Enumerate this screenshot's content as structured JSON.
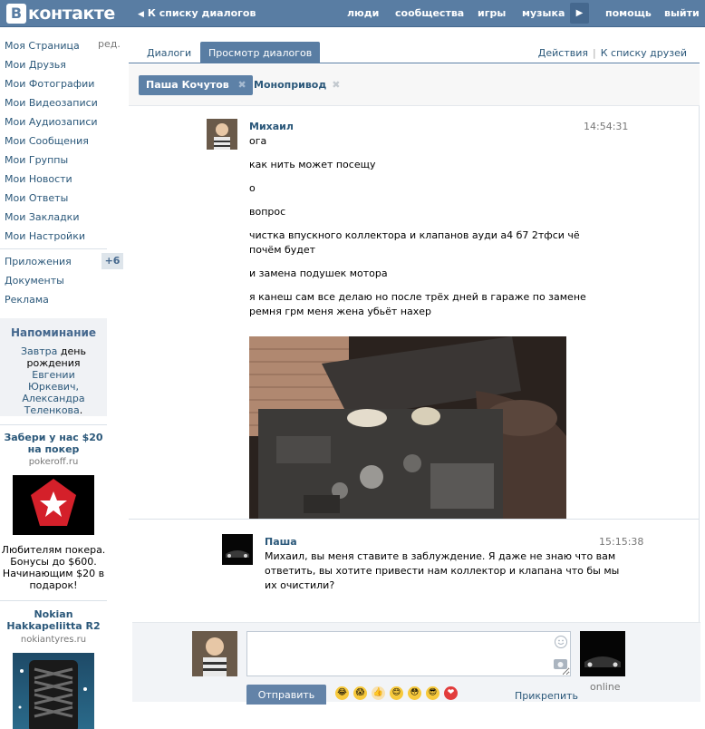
{
  "topbar": {
    "logo_letter": "В",
    "logo_text": "контакте",
    "back_label": "К списку диалогов",
    "nav": [
      "люди",
      "сообщества",
      "игры",
      "музыка",
      "помощь",
      "выйти"
    ]
  },
  "sidebar": {
    "edit_label": "ред.",
    "items": [
      "Моя Страница",
      "Мои Друзья",
      "Мои Фотографии",
      "Мои Видеозаписи",
      "Мои Аудиозаписи",
      "Мои Сообщения",
      "Мои Группы",
      "Мои Новости",
      "Мои Ответы",
      "Мои Закладки",
      "Мои Настройки"
    ],
    "items2": [
      "Приложения",
      "Документы",
      "Реклама"
    ],
    "apps_badge": "+6"
  },
  "reminder": {
    "title": "Напоминание",
    "day_link": "Завтра",
    "text1": "день рождения",
    "people": "Евгении Юркевич, Александра Теленкова",
    "dot": "."
  },
  "ads": [
    {
      "title": "Забери у нас $20 на покер",
      "domain": "pokeroff.ru",
      "text": "Любителям покера. Бонусы до $600. Начинающим $20 в подарок!"
    },
    {
      "title": "Nokian Hakkapeliitta R2",
      "domain": "nokiantyres.ru"
    }
  ],
  "tabs": {
    "dialogs": "Диалоги",
    "view": "Просмотр диалогов",
    "actions": "Действия",
    "friends": "К списку друзей"
  },
  "filters": {
    "first": "Паша Кочутов",
    "second": "Монопривод",
    "remove_glyph": "✖"
  },
  "messages": [
    {
      "author": "Михаил",
      "time": "14:54:31",
      "lines": [
        "ога",
        "как нить может посещу",
        "о",
        "вопрос",
        "чистка впускного коллектора и клапанов ауди а4 б7 2тфси чё",
        "почём будет",
        "и замена подушек мотора",
        "я канеш сам все делаю но после трёх дней в гараже по замене",
        "ремня грм меня жена убьёт нахер"
      ]
    },
    {
      "author": "Паша",
      "time": "15:15:38",
      "lines": [
        "Михаил, вы меня ставите в заблуждение. Я даже не знаю что вам",
        "ответить, вы хотите привести нам коллектор и клапана что бы мы",
        "их очистили?"
      ]
    }
  ],
  "composer": {
    "input_value": "",
    "send_label": "Отправить",
    "attach_label": "Прикрепить",
    "online_label": "online"
  },
  "colors": {
    "header": "#597da3",
    "link": "#2b587a",
    "tab_active": "#597da3"
  }
}
